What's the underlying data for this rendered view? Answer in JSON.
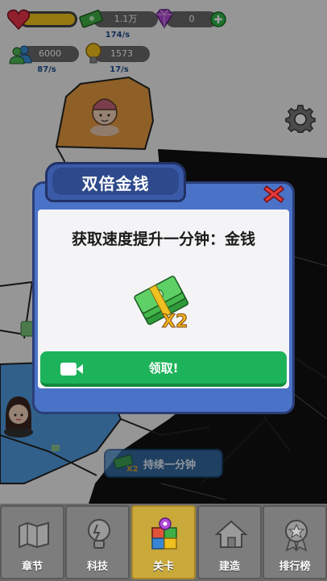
{
  "hud": {
    "money_value": "1.1万",
    "money_rate": "174/s",
    "gem_value": "0",
    "people_value": "6000",
    "people_rate": "87/s",
    "idea_value": "1573",
    "idea_rate": "17/s",
    "health_fraction": 1.0
  },
  "dialog": {
    "title": "双倍金钱",
    "message": "获取速度提升一分钟：金钱",
    "multiplier": "X2",
    "claim_label": "领取!"
  },
  "persist": {
    "label": "持续一分钟",
    "multiplier": "X2"
  },
  "nav": {
    "items": [
      {
        "label": "章节",
        "icon": "map-icon"
      },
      {
        "label": "科技",
        "icon": "lightbulb-icon"
      },
      {
        "label": "关卡",
        "icon": "puzzle-icon"
      },
      {
        "label": "建造",
        "icon": "house-icon"
      },
      {
        "label": "排行榜",
        "icon": "medal-icon"
      }
    ],
    "active_index": 2
  },
  "colors": {
    "accent_blue": "#4a73c8",
    "claim_green": "#1db35a",
    "active_nav": "#c9a93a"
  }
}
